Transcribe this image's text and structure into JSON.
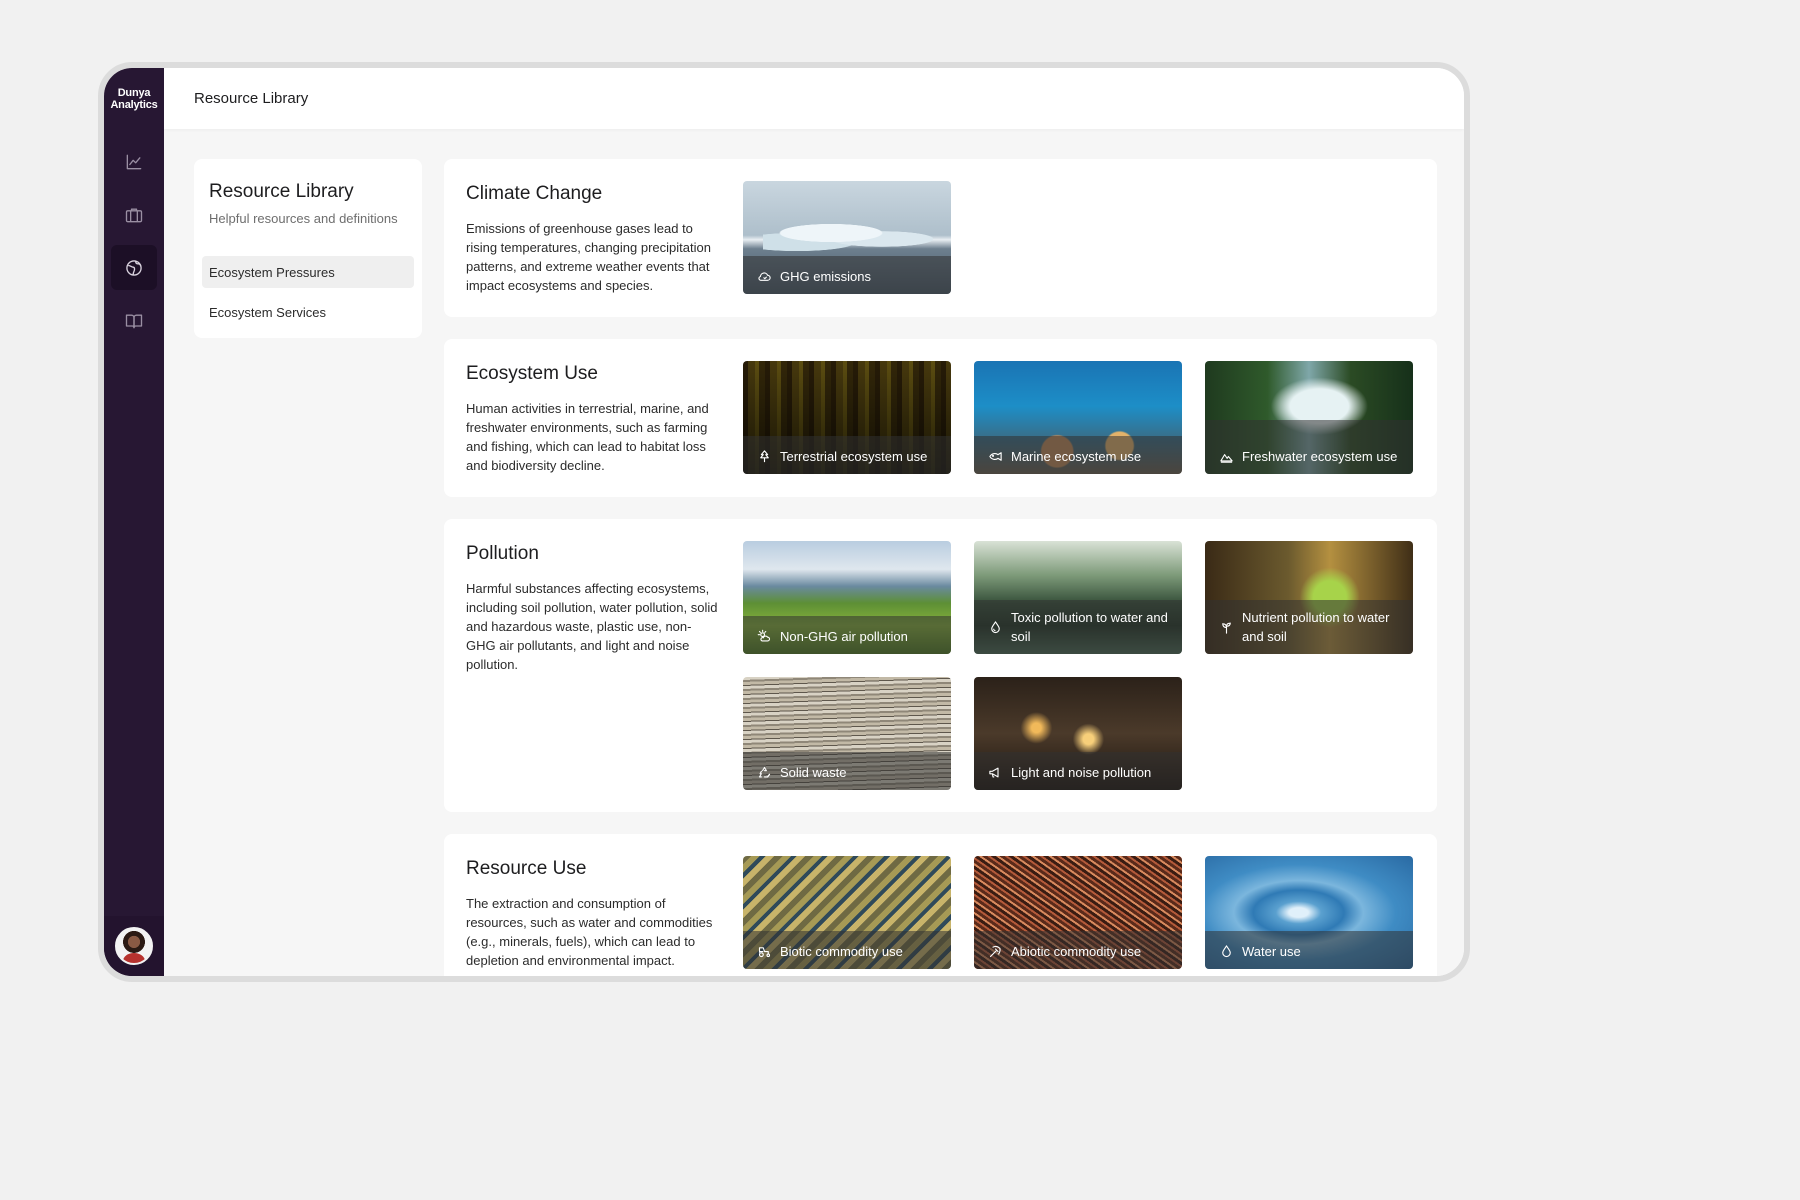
{
  "brand": {
    "line1": "Dunya",
    "line2": "Analytics"
  },
  "topbar": {
    "title": "Resource Library"
  },
  "sidebar": {
    "nav": [
      {
        "icon": "line-chart-icon"
      },
      {
        "icon": "briefcase-icon"
      },
      {
        "icon": "globe-icon",
        "active": true
      },
      {
        "icon": "book-icon"
      }
    ]
  },
  "left_panel": {
    "title": "Resource Library",
    "subtitle": "Helpful resources and definitions",
    "items": [
      {
        "label": "Ecosystem Pressures",
        "active": true
      },
      {
        "label": "Ecosystem Services"
      }
    ]
  },
  "sections": [
    {
      "title": "Climate Change",
      "description": "Emissions of greenhouse gases lead to rising temperatures, changing precipitation patterns, and extreme weather events that impact ecosystems and species.",
      "cards": [
        {
          "label": "GHG emissions",
          "icon": "cloud-icon"
        }
      ]
    },
    {
      "title": "Ecosystem Use",
      "description": "Human activities in terrestrial, marine, and freshwater environments, such as farming and fishing, which can lead to habitat loss and biodiversity decline.",
      "cards": [
        {
          "label": "Terrestrial ecosystem use",
          "icon": "tree-icon"
        },
        {
          "label": "Marine ecosystem use",
          "icon": "fish-icon"
        },
        {
          "label": "Freshwater ecosystem use",
          "icon": "mountain-icon"
        }
      ]
    },
    {
      "title": "Pollution",
      "description": "Harmful substances affecting ecosystems, including soil pollution, water pollution, solid and hazardous waste, plastic use, non-GHG air pollutants, and light and noise pollution.",
      "cards": [
        {
          "label": "Non-GHG air pollution",
          "icon": "sun-cloud-icon"
        },
        {
          "label": "Toxic pollution to water and soil",
          "icon": "droplet-icon"
        },
        {
          "label": "Nutrient pollution to water and soil",
          "icon": "sprout-icon"
        },
        {
          "label": "Solid waste",
          "icon": "recycle-icon"
        },
        {
          "label": "Light and noise pollution",
          "icon": "megaphone-icon"
        }
      ]
    },
    {
      "title": "Resource Use",
      "description": "The extraction and consumption of resources, such as water and commodities (e.g., minerals, fuels), which can lead to depletion and environmental impact.",
      "cards": [
        {
          "label": "Biotic commodity use",
          "icon": "tractor-icon"
        },
        {
          "label": "Abiotic commodity use",
          "icon": "pickaxe-icon"
        },
        {
          "label": "Water use",
          "icon": "water-drop-icon"
        }
      ]
    }
  ]
}
